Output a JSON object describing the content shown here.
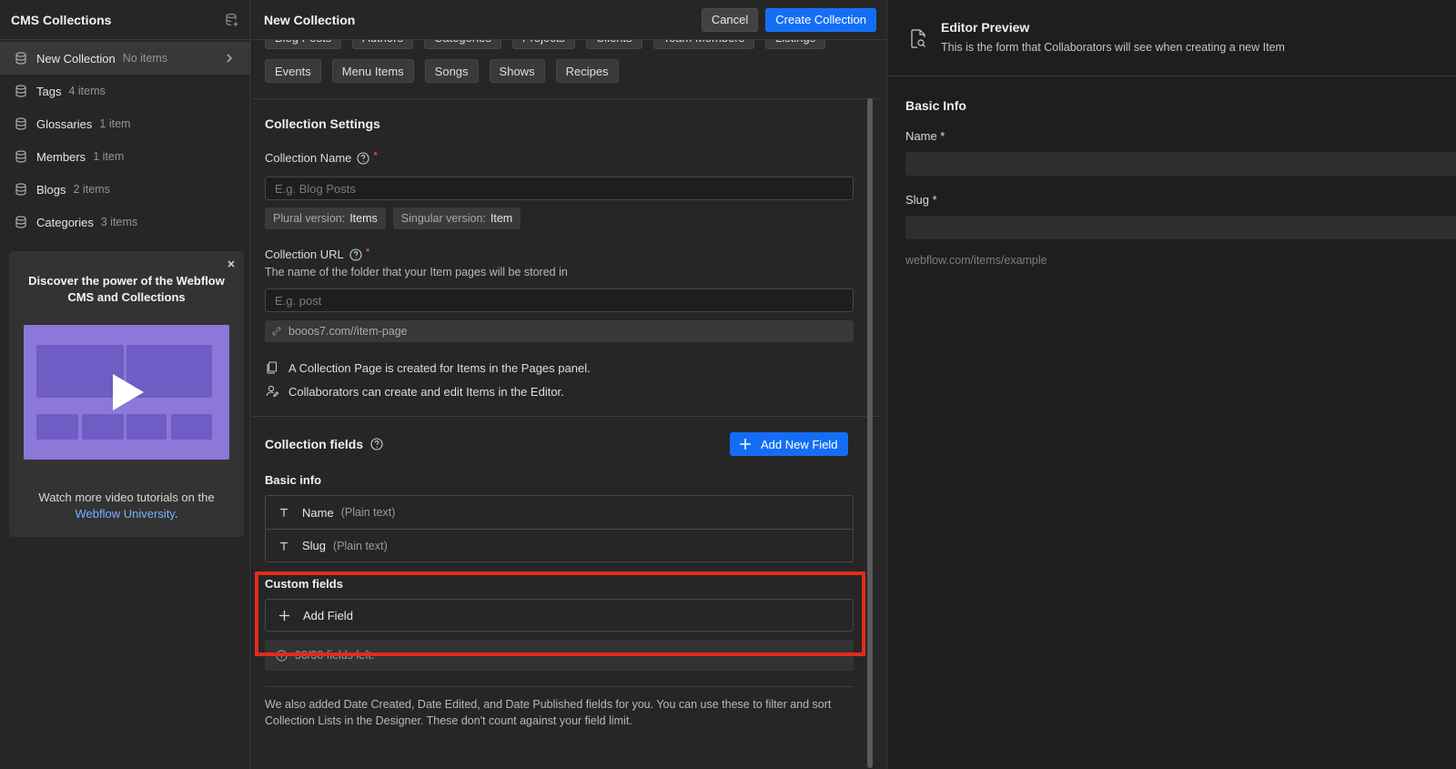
{
  "sidebar": {
    "title": "CMS Collections",
    "items": [
      {
        "label": "New Collection",
        "count": "No items"
      },
      {
        "label": "Tags",
        "count": "4 items"
      },
      {
        "label": "Glossaries",
        "count": "1 item"
      },
      {
        "label": "Members",
        "count": "1 item"
      },
      {
        "label": "Blogs",
        "count": "2 items"
      },
      {
        "label": "Categories",
        "count": "3 items"
      }
    ],
    "promo": {
      "title": "Discover the power of the Webflow CMS and Collections",
      "text_prefix": "Watch more video tutorials on the",
      "link_text": "Webflow University",
      "text_suffix": "."
    }
  },
  "panel": {
    "title": "New Collection",
    "cancel_label": "Cancel",
    "create_label": "Create Collection",
    "templates_partial": [
      "Blog Posts",
      "Authors",
      "Categories",
      "Projects",
      "Clients",
      "Team Members",
      "Listings"
    ],
    "templates": [
      "Events",
      "Menu Items",
      "Songs",
      "Shows",
      "Recipes"
    ],
    "settings": {
      "title": "Collection Settings",
      "name_label": "Collection Name",
      "name_placeholder": "E.g. Blog Posts",
      "plural_key": "Plural version:",
      "plural_value": "Items",
      "singular_key": "Singular version:",
      "singular_value": "Item",
      "url_label": "Collection URL",
      "url_desc": "The name of the folder that your Item pages will be stored in",
      "url_placeholder": "E.g. post",
      "url_preview": "booos7.com//item-page",
      "info_pages": "A Collection Page is created for Items in the Pages panel.",
      "info_editor": "Collaborators can create and edit Items in the Editor.",
      "required_mark": "*"
    },
    "fields": {
      "title": "Collection fields",
      "add_new_label": "Add New Field",
      "basic_title": "Basic info",
      "basic": [
        {
          "name": "Name",
          "type": "(Plain text)"
        },
        {
          "name": "Slug",
          "type": "(Plain text)"
        }
      ],
      "custom_title": "Custom fields",
      "add_field_label": "Add Field",
      "fields_left": "30/30 fields left.",
      "footnote": "We also added Date Created, Date Edited, and Date Published fields for you. You can use these to filter and sort Collection Lists in the Designer. These don't count against your field limit."
    }
  },
  "preview": {
    "title": "Editor Preview",
    "subtitle": "This is the form that Collaborators will see when creating a new Item",
    "section": "Basic Info",
    "name_label": "Name *",
    "slug_label": "Slug *",
    "hint": "webflow.com/items/example"
  },
  "colors": {
    "accent": "#146ef5",
    "highlight": "#e52a1a",
    "link": "#7ab0ff"
  },
  "icons": {
    "sidebar_header": "database-add-icon",
    "collection": "database-icon",
    "play": "play-icon",
    "help": "help-circle-icon",
    "link": "link-icon",
    "pages": "pages-icon",
    "collaborators": "user-edit-icon",
    "text_field": "text-type-icon",
    "plus": "plus-icon",
    "info": "info-icon",
    "preview": "file-search-icon"
  }
}
